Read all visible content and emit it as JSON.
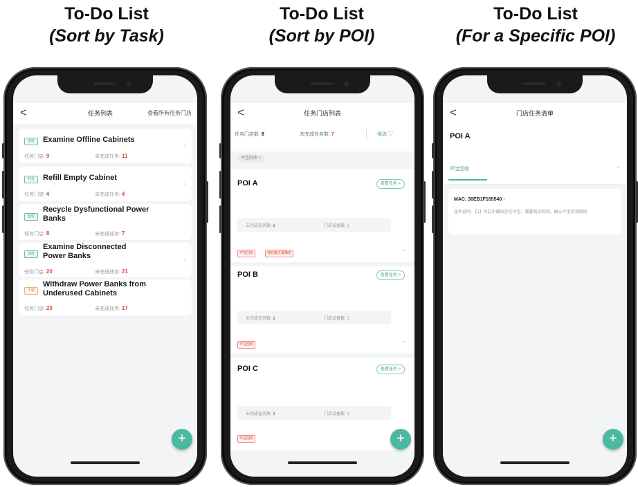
{
  "columns": [
    {
      "title": "To-Do List",
      "subtitle": "(Sort by Task)"
    },
    {
      "title": "To-Do List",
      "subtitle": "(Sort by POI)"
    },
    {
      "title": "To-Do List",
      "subtitle": "(For a Specific POI)"
    }
  ],
  "screen1": {
    "back": "<",
    "nav_title": "任务列表",
    "nav_right": "查看所有任务门店",
    "tasks": [
      {
        "tag": "巡检",
        "title": "Examine Offline Cabinets",
        "stores_label": "任务门店:",
        "stores": "9",
        "pending_label": "未完成任务:",
        "pending": "11"
      },
      {
        "tag": "补宝",
        "title": "Refill Empty Cabinet",
        "stores_label": "任务门店:",
        "stores": "4",
        "pending_label": "未完成任务:",
        "pending": "4"
      },
      {
        "tag": "回收",
        "title": "Recycle Dysfunctional Power Banks",
        "stores_label": "任务门店:",
        "stores": "8",
        "pending_label": "未完成任务:",
        "pending": "7"
      },
      {
        "tag": "巡检",
        "title": "Examine Disconnected Power Banks",
        "stores_label": "任务门店:",
        "stores": "20",
        "pending_label": "未完成任务:",
        "pending": "21"
      },
      {
        "tag": "下架",
        "title": "Withdraw Power Banks from Underused Cabinets",
        "stores_label": "任务门店:",
        "stores": "20",
        "pending_label": "未完成任务:",
        "pending": "17"
      }
    ],
    "fab": "+"
  },
  "screen2": {
    "back": "<",
    "nav_title": "任务门店列表",
    "stores_label": "任务门店数:",
    "stores": "8",
    "pending_label": "未完成任务数:",
    "pending": "7",
    "filter": "筛选",
    "filter_chip": "坏宝回收 ×",
    "pois": [
      {
        "name": "POI A",
        "view": "查看任务 >",
        "pending_label": "未完成任务数:",
        "pending": "1",
        "devices_label": "门店设备数:",
        "devices": "1",
        "tags": [
          "坏宝回收",
          "待收集位置确定"
        ]
      },
      {
        "name": "POI B",
        "view": "查看任务 >",
        "pending_label": "未完成任务数:",
        "pending": "1",
        "devices_label": "门店设备数:",
        "devices": "1",
        "tags": [
          "坏宝回收"
        ]
      },
      {
        "name": "POI C",
        "view": "查看任务 >",
        "pending_label": "未完成任务数:",
        "pending": "1",
        "devices_label": "门店设备数:",
        "devices": "1",
        "tags": [
          "坏宝回收"
        ]
      }
    ],
    "fab": "+"
  },
  "screen3": {
    "back": "<",
    "nav_title": "门店任务清单",
    "poi_name": "POI A",
    "tab": "坏宝回收",
    "mac": "MAC:  30EB1F165540",
    "desc": "任务说明: 【1】台口中疑似存在坏宝，需要到店检测，确认坏宝后请取回",
    "fab": "+"
  },
  "colors": {
    "accent": "#4cb8a2",
    "alert": "#e04a3b"
  }
}
